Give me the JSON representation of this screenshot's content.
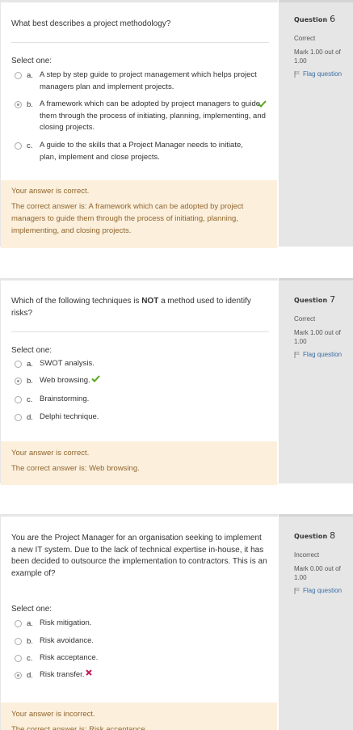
{
  "questions": [
    {
      "title_label": "Question",
      "number": "6",
      "state": "Correct",
      "grade": "Mark 1.00 out of 1.00",
      "flag_label": "Flag question",
      "text": "What best describes a project methodology?",
      "prompt": "Select one:",
      "options": [
        {
          "letter": "a.",
          "label": "A step by step guide to project management which helps project managers plan and implement projects.",
          "checked": false,
          "mark": ""
        },
        {
          "letter": "b.",
          "label": "A framework which can be adopted by project managers to guide them through the process of initiating, planning, implementing, and closing projects.",
          "checked": true,
          "mark": "correct"
        },
        {
          "letter": "c.",
          "label": "A guide to the skills that a Project Manager needs to initiate, plan, implement and close projects.",
          "checked": false,
          "mark": ""
        }
      ],
      "feedback": "Your answer is correct.",
      "right_answer": "The correct answer is: A framework which can be adopted by project managers to guide them through the process of initiating, planning, implementing, and closing projects."
    },
    {
      "title_label": "Question",
      "number": "7",
      "state": "Correct",
      "grade": "Mark 1.00 out of 1.00",
      "flag_label": "Flag question",
      "text_before": "Which of the following techniques is ",
      "text_bold": "NOT",
      "text_after": " a method used to identify risks?",
      "prompt": "Select one:",
      "options": [
        {
          "letter": "a.",
          "label": "SWOT analysis.",
          "checked": false,
          "mark": ""
        },
        {
          "letter": "b.",
          "label": "Web browsing.",
          "checked": true,
          "mark": "correct"
        },
        {
          "letter": "c.",
          "label": "Brainstorming.",
          "checked": false,
          "mark": ""
        },
        {
          "letter": "d.",
          "label": "Delphi technique.",
          "checked": false,
          "mark": ""
        }
      ],
      "feedback": "Your answer is correct.",
      "right_answer": "The correct answer is: Web browsing."
    },
    {
      "title_label": "Question",
      "number": "8",
      "state": "Incorrect",
      "grade": "Mark 0.00 out of 1.00",
      "flag_label": "Flag question",
      "text": "You are the Project Manager for an organisation seeking to implement a new IT system.  Due to the lack of technical expertise in-house, it has been decided to outsource the implementation to contractors. This is an example of?",
      "prompt": "Select one:",
      "options": [
        {
          "letter": "a.",
          "label": "Risk mitigation.",
          "checked": false,
          "mark": ""
        },
        {
          "letter": "b.",
          "label": "Risk avoidance.",
          "checked": false,
          "mark": ""
        },
        {
          "letter": "c.",
          "label": "Risk acceptance.",
          "checked": false,
          "mark": ""
        },
        {
          "letter": "d.",
          "label": "Risk transfer.",
          "checked": true,
          "mark": "incorrect"
        }
      ],
      "feedback": "Your answer is incorrect.",
      "right_answer": "The correct answer is: Risk acceptance."
    }
  ],
  "colors": {
    "correct_mark": "#5aa51f",
    "incorrect_mark": "#c2185b",
    "outcome_bg": "#fcefdc",
    "outcome_text": "#8e662e",
    "flag_link": "#3a6ea5"
  }
}
